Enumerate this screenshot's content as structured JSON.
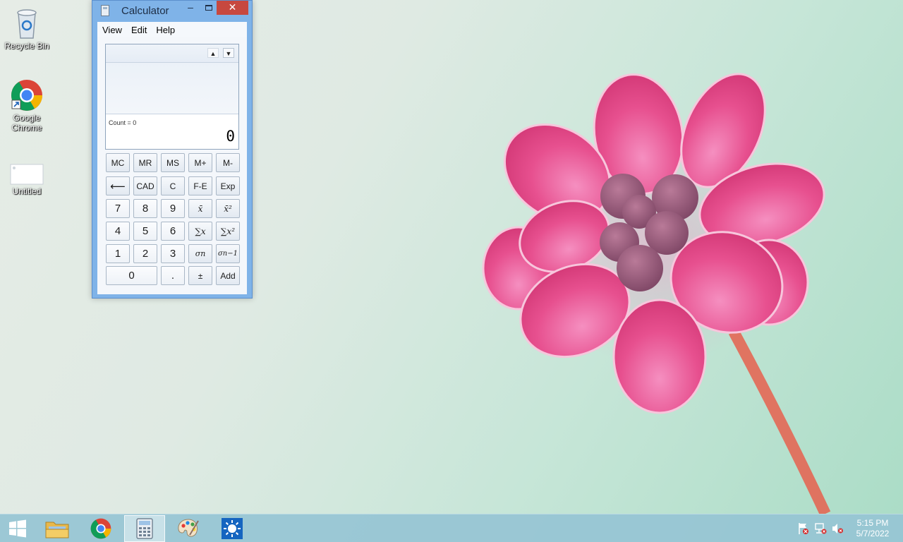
{
  "desktop": {
    "icons": [
      {
        "label": "Recycle Bin",
        "icon": "recycle-bin-icon"
      },
      {
        "label": "Google Chrome",
        "icon": "chrome-icon"
      },
      {
        "label": "Untitled",
        "icon": "blank-document-icon"
      }
    ]
  },
  "calculator": {
    "title": "Calculator",
    "window_buttons": {
      "minimize": "–",
      "close": "✕"
    },
    "menu": [
      "View",
      "Edit",
      "Help"
    ],
    "history_arrows": {
      "up": "▲",
      "down": "▼"
    },
    "count_text": "Count = 0",
    "display_value": "0",
    "buttons": {
      "row1": [
        "MC",
        "MR",
        "MS",
        "M+",
        "M-"
      ],
      "row2": [
        "⟵",
        "CAD",
        "C",
        "F-E",
        "Exp"
      ],
      "row3": [
        "7",
        "8",
        "9",
        "x̄",
        "x̄²"
      ],
      "row4": [
        "4",
        "5",
        "6",
        "∑x",
        "∑x²"
      ],
      "row5": [
        "1",
        "2",
        "3",
        "σn",
        "σn−1"
      ],
      "row6": [
        "0",
        ".",
        "±",
        "Add"
      ]
    }
  },
  "taskbar": {
    "items": [
      "start-button",
      "file-explorer",
      "chrome",
      "calculator",
      "paint",
      "settings"
    ],
    "active_item": "calculator",
    "tray": [
      "action-center-flag-icon",
      "network-icon",
      "volume-muted-icon"
    ],
    "time": "5:15 PM",
    "date": "5/7/2022"
  },
  "colors": {
    "window_frame": "#7fb3e8",
    "close_button": "#c7483f",
    "taskbar": "#96c4d4",
    "flower": "#e8508f"
  }
}
